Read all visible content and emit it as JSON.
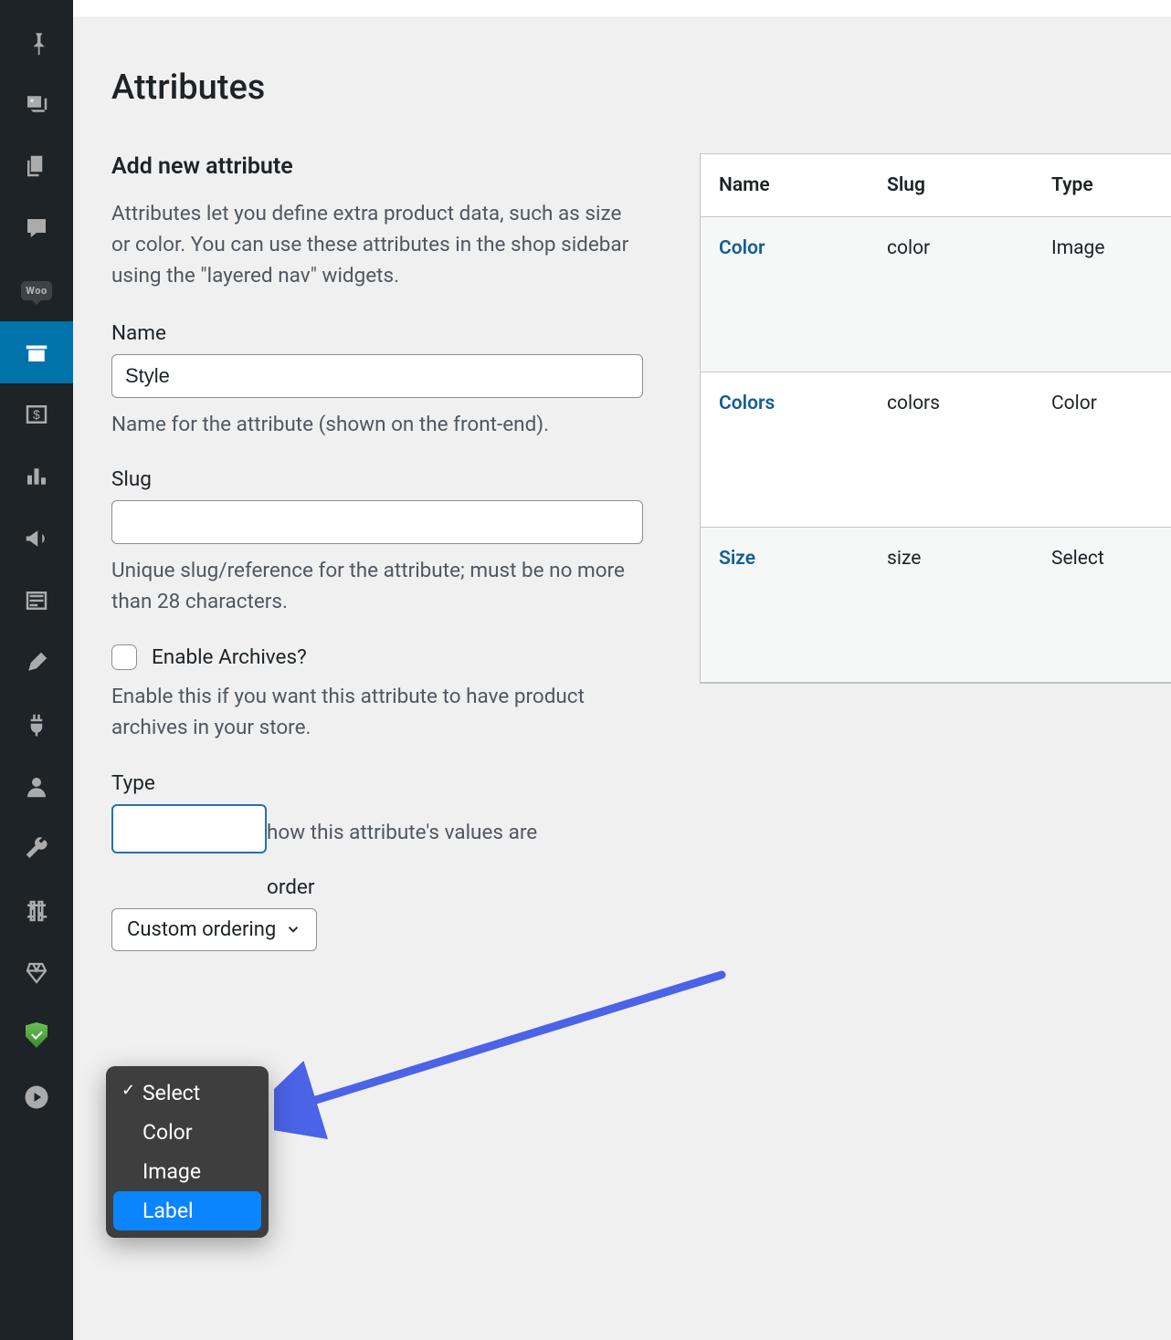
{
  "page": {
    "title": "Attributes"
  },
  "form": {
    "heading": "Add new attribute",
    "intro": "Attributes let you define extra product data, such as size or color. You can use these attributes in the shop sidebar using the \"layered nav\" widgets.",
    "name_label": "Name",
    "name_value": "Style",
    "name_hint": "Name for the attribute (shown on the front-end).",
    "slug_label": "Slug",
    "slug_value": "",
    "slug_hint": "Unique slug/reference for the attribute; must be no more than 28 characters.",
    "archives_label": "Enable Archives?",
    "archives_hint": "Enable this if you want this attribute to have product archives in your store.",
    "type_label": "Type",
    "type_hint": "how this attribute's values are",
    "type_options": {
      "select": "Select",
      "color": "Color",
      "image": "Image",
      "label": "Label"
    },
    "order_label": "order",
    "order_value": "Custom ordering"
  },
  "table": {
    "head_name": "Name",
    "head_slug": "Slug",
    "head_type": "Type",
    "rows": [
      {
        "name": "Color",
        "slug": "color",
        "type": "Image"
      },
      {
        "name": "Colors",
        "slug": "colors",
        "type": "Color"
      },
      {
        "name": "Size",
        "slug": "size",
        "type": "Select"
      }
    ]
  }
}
